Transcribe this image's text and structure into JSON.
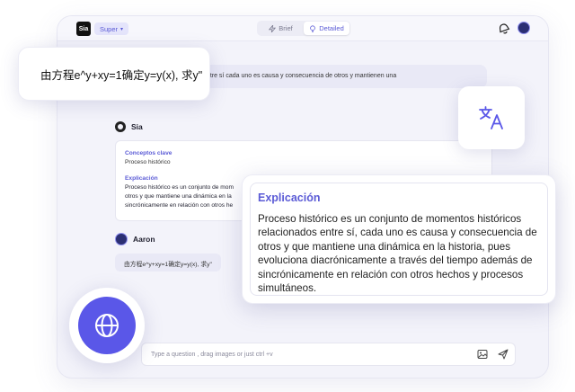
{
  "header": {
    "logo": "Sia",
    "model": "Super",
    "tabs": [
      {
        "label": "Brief"
      },
      {
        "label": "Detailed"
      }
    ]
  },
  "chat": {
    "user_question": "icos relacionados entre sí cada uno es causa y consecuencia de otros y mantienen una",
    "assistant_name": "Sia",
    "answer": {
      "h1": "Conceptos clave",
      "p1": "Proceso histórico",
      "h2": "Explicación",
      "lines": [
        "Proceso histórico es un conjunto de mom",
        "otros y que mantiene una dinámica en la",
        "sincrónicamente en relación con otros he"
      ]
    },
    "user_name": "Aaron",
    "user_message": "由方程e^y+xy=1确定y=y(x), 求y\""
  },
  "input": {
    "placeholder": "Type a question , drag images or just ctrl +v"
  },
  "cards": {
    "formula": "由方程e^y+xy=1确定y=y(x), 求y\"",
    "explain_title": "Explicación",
    "explain_body": "Proceso histórico es un conjunto de momentos históricos relacionados entre sí, cada uno es causa y consecuencia de otros y que mantiene una dinámica en la historia, pues evoluciona diacrónicamente a través del tiempo además de sincrónicamente en relación con otros hechos y procesos simultáneos."
  },
  "icons": {
    "translate": "translate-icon",
    "globe": "globe-icon",
    "bell": "bell-icon",
    "image": "image-icon",
    "send": "send-icon"
  },
  "colors": {
    "accent": "#5b5bd6",
    "globe": "#5a57e8"
  }
}
